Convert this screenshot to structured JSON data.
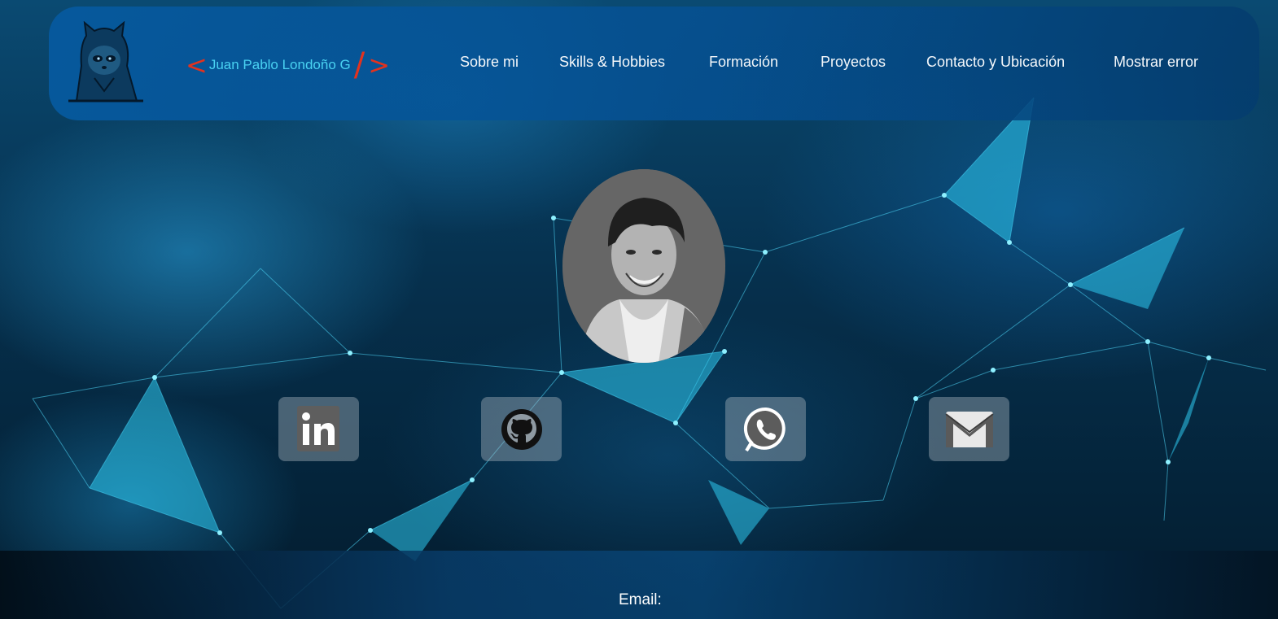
{
  "header": {
    "logo_icon": "hooded-raccoon-logo",
    "brand": {
      "open_bracket": "<",
      "name": "Juan Pablo Londoño G",
      "slash": "/",
      "close_bracket": ">"
    },
    "nav": [
      {
        "label": "Sobre mi"
      },
      {
        "label": "Skills & Hobbies"
      },
      {
        "label": "Formación"
      },
      {
        "label": "Proyectos"
      },
      {
        "label": "Contacto y Ubicación"
      },
      {
        "label": "Mostrar error"
      }
    ]
  },
  "profile": {
    "photo_icon": "profile-photo"
  },
  "social": [
    {
      "name": "linkedin",
      "icon": "linkedin-icon"
    },
    {
      "name": "github",
      "icon": "github-icon"
    },
    {
      "name": "whatsapp",
      "icon": "whatsapp-icon"
    },
    {
      "name": "gmail",
      "icon": "mail-icon"
    }
  ],
  "footer": {
    "email_label": "Email:"
  },
  "colors": {
    "accent_red": "#e2321e",
    "accent_cyan": "#49d2f2",
    "nav_bg": "#0659a0"
  }
}
